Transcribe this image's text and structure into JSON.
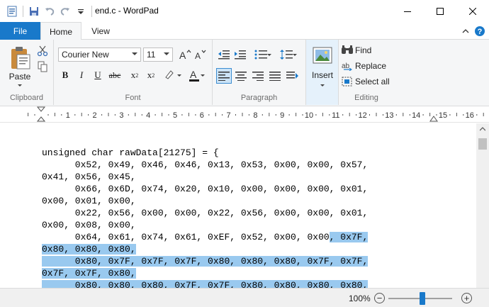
{
  "window": {
    "title": "end.c - WordPad"
  },
  "tabs": {
    "file": "File",
    "home": "Home",
    "view": "View"
  },
  "ribbon": {
    "clipboard": {
      "label": "Clipboard",
      "paste_label": "Paste"
    },
    "font": {
      "label": "Font",
      "family_value": "Courier New",
      "size_value": "11"
    },
    "paragraph": {
      "label": "Paragraph"
    },
    "insert": {
      "label": "Insert"
    },
    "editing": {
      "label": "Editing",
      "find": "Find",
      "replace": "Replace",
      "select_all": "Select all"
    }
  },
  "ruler": {
    "numbers": [
      "1",
      "2",
      "3",
      "4",
      "5",
      "6",
      "7",
      "8",
      "9",
      "10",
      "11",
      "12",
      "13",
      "14",
      "15",
      "16"
    ]
  },
  "document": {
    "lines": [
      {
        "text": "unsigned char rawData[21275] = {",
        "hl": ""
      },
      {
        "text": "      0x52, 0x49, 0x46, 0x46, 0x13, 0x53, 0x00, 0x00, 0x57,",
        "hl": ""
      },
      {
        "text": "0x41, 0x56, 0x45,",
        "hl": ""
      },
      {
        "text": "      0x66, 0x6D, 0x74, 0x20, 0x10, 0x00, 0x00, 0x00, 0x01,",
        "hl": ""
      },
      {
        "text": "0x00, 0x01, 0x00,",
        "hl": ""
      },
      {
        "text": "      0x22, 0x56, 0x00, 0x00, 0x22, 0x56, 0x00, 0x00, 0x01,",
        "hl": ""
      },
      {
        "text": "0x00, 0x08, 0x00,",
        "hl": ""
      },
      {
        "text": "      0x64, 0x61, 0x74, 0x61, 0xEF, 0x52, 0x00, 0x00",
        "hl": ", 0x7F,"
      },
      {
        "text": "",
        "hl": "0x80, 0x80, 0x80,"
      },
      {
        "text": "",
        "hl": "      0x80, 0x7F, 0x7F, 0x7F, 0x80, 0x80, 0x80, 0x7F, 0x7F,"
      },
      {
        "text": "",
        "hl": "0x7F, 0x7F, 0x80,"
      },
      {
        "text": "",
        "hl": "      0x80, 0x80, 0x80, 0x7F, 0x7F, 0x80, 0x80, 0x80, 0x80,"
      }
    ]
  },
  "status": {
    "zoom": "100%",
    "zoom_level_percent": 100
  },
  "colors": {
    "accent": "#1979ca",
    "selection": "#99c9ef",
    "ribbon_bg": "#f5f6f7"
  },
  "icons": [
    "wordpad-app-icon",
    "save-icon",
    "undo-icon",
    "redo-icon",
    "customize-qat-icon",
    "minimize-icon",
    "maximize-icon",
    "close-icon",
    "help-icon",
    "collapse-ribbon-icon",
    "paste-icon",
    "cut-icon",
    "copy-icon",
    "grow-font-icon",
    "shrink-font-icon",
    "bold-icon",
    "italic-icon",
    "underline-icon",
    "strikethrough-icon",
    "subscript-icon",
    "superscript-icon",
    "highlight-icon",
    "font-color-icon",
    "decrease-indent-icon",
    "increase-indent-icon",
    "bullets-icon",
    "line-spacing-icon",
    "align-left-icon",
    "align-center-icon",
    "align-right-icon",
    "justify-icon",
    "paragraph-icon",
    "insert-picture-icon",
    "find-icon",
    "replace-icon",
    "select-all-icon",
    "zoom-out-icon",
    "zoom-in-icon"
  ]
}
